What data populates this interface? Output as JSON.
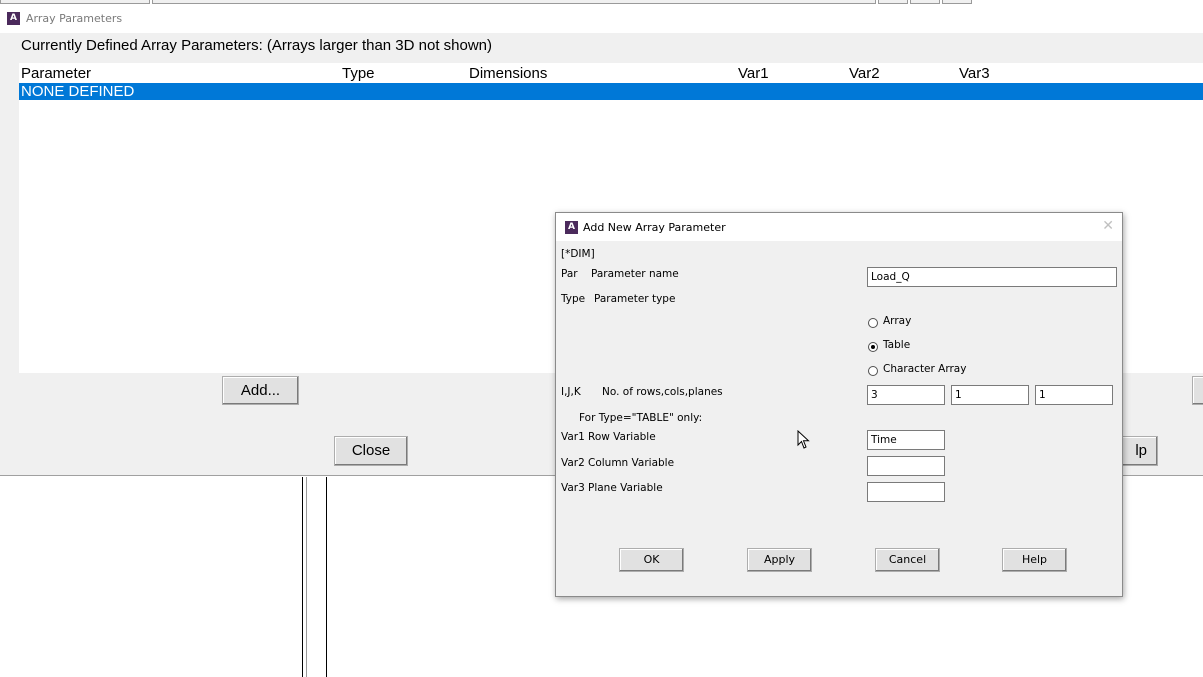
{
  "main_window": {
    "title": "Array Parameters",
    "heading": "Currently Defined Array Parameters: (Arrays larger than 3D not shown)",
    "columns": [
      "Parameter",
      "Type",
      "Dimensions",
      "Var1",
      "Var2",
      "Var3"
    ],
    "rows": [
      "NONE DEFINED"
    ],
    "add_label": "Add...",
    "close_label": "Close",
    "help_partial_label": "lp"
  },
  "dialog": {
    "title": "Add New Array Parameter",
    "command": "[*DIM]",
    "par_key": "Par",
    "par_label": "Parameter name",
    "par_value": "Load_Q",
    "type_key": "Type",
    "type_label": "Parameter type",
    "type_options": [
      "Array",
      "Table",
      "Character Array"
    ],
    "type_selected": "Table",
    "ijk_key": "I,J,K",
    "ijk_label": "No. of rows,cols,planes",
    "ijk_values": [
      "3",
      "1",
      "1"
    ],
    "table_only_note": "For Type=\"TABLE\" only:",
    "var1_key": "Var1",
    "var1_label": "Row Variable",
    "var1_value": "Time",
    "var2_key": "Var2",
    "var2_label": "Column Variable",
    "var2_value": "",
    "var3_key": "Var3",
    "var3_label": "Plane Variable",
    "var3_value": "",
    "buttons": [
      "OK",
      "Apply",
      "Cancel",
      "Help"
    ]
  },
  "colors": {
    "selection": "#0078d7",
    "app_icon": "#4b2a5c"
  },
  "icons": {
    "app": "ansys-logo-icon",
    "close": "close-icon",
    "cursor": "mouse-pointer-icon"
  }
}
